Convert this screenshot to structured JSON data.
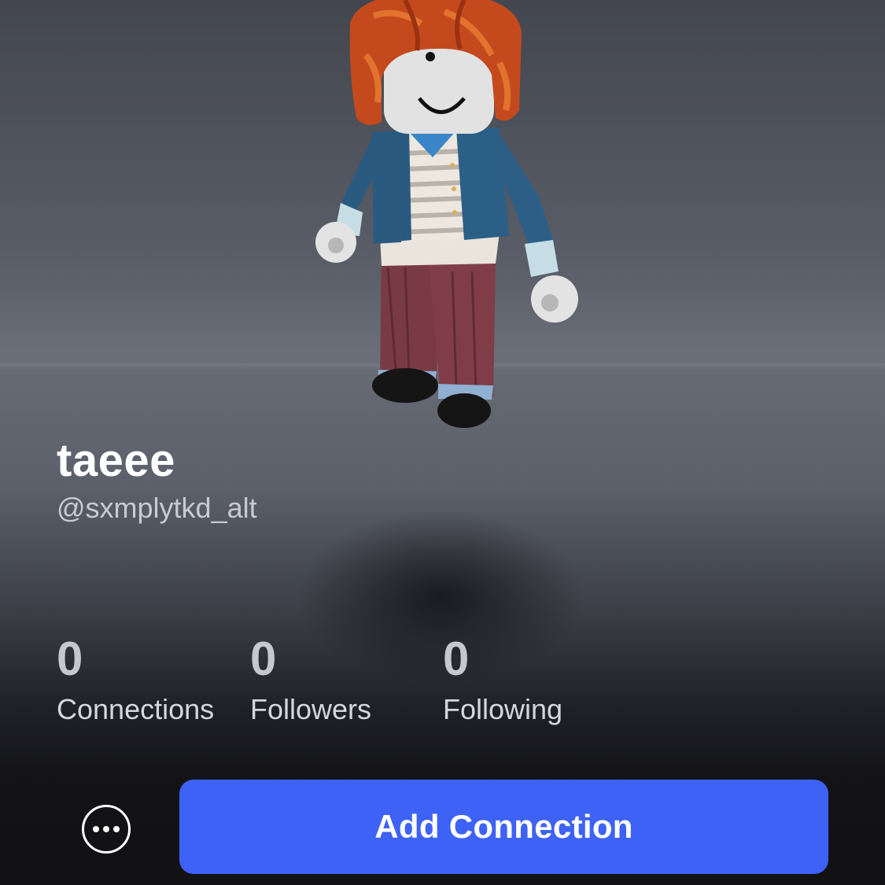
{
  "profile": {
    "display_name": "taeee",
    "username": "@sxmplytkd_alt"
  },
  "stats": [
    {
      "count": "0",
      "label": "Connections"
    },
    {
      "count": "0",
      "label": "Followers"
    },
    {
      "count": "0",
      "label": "Following"
    }
  ],
  "actions": {
    "more_icon": "ellipsis-circle-icon",
    "add_connection_label": "Add Connection"
  },
  "colors": {
    "primary_button": "#3e62f5",
    "background_dark": "#121215"
  }
}
